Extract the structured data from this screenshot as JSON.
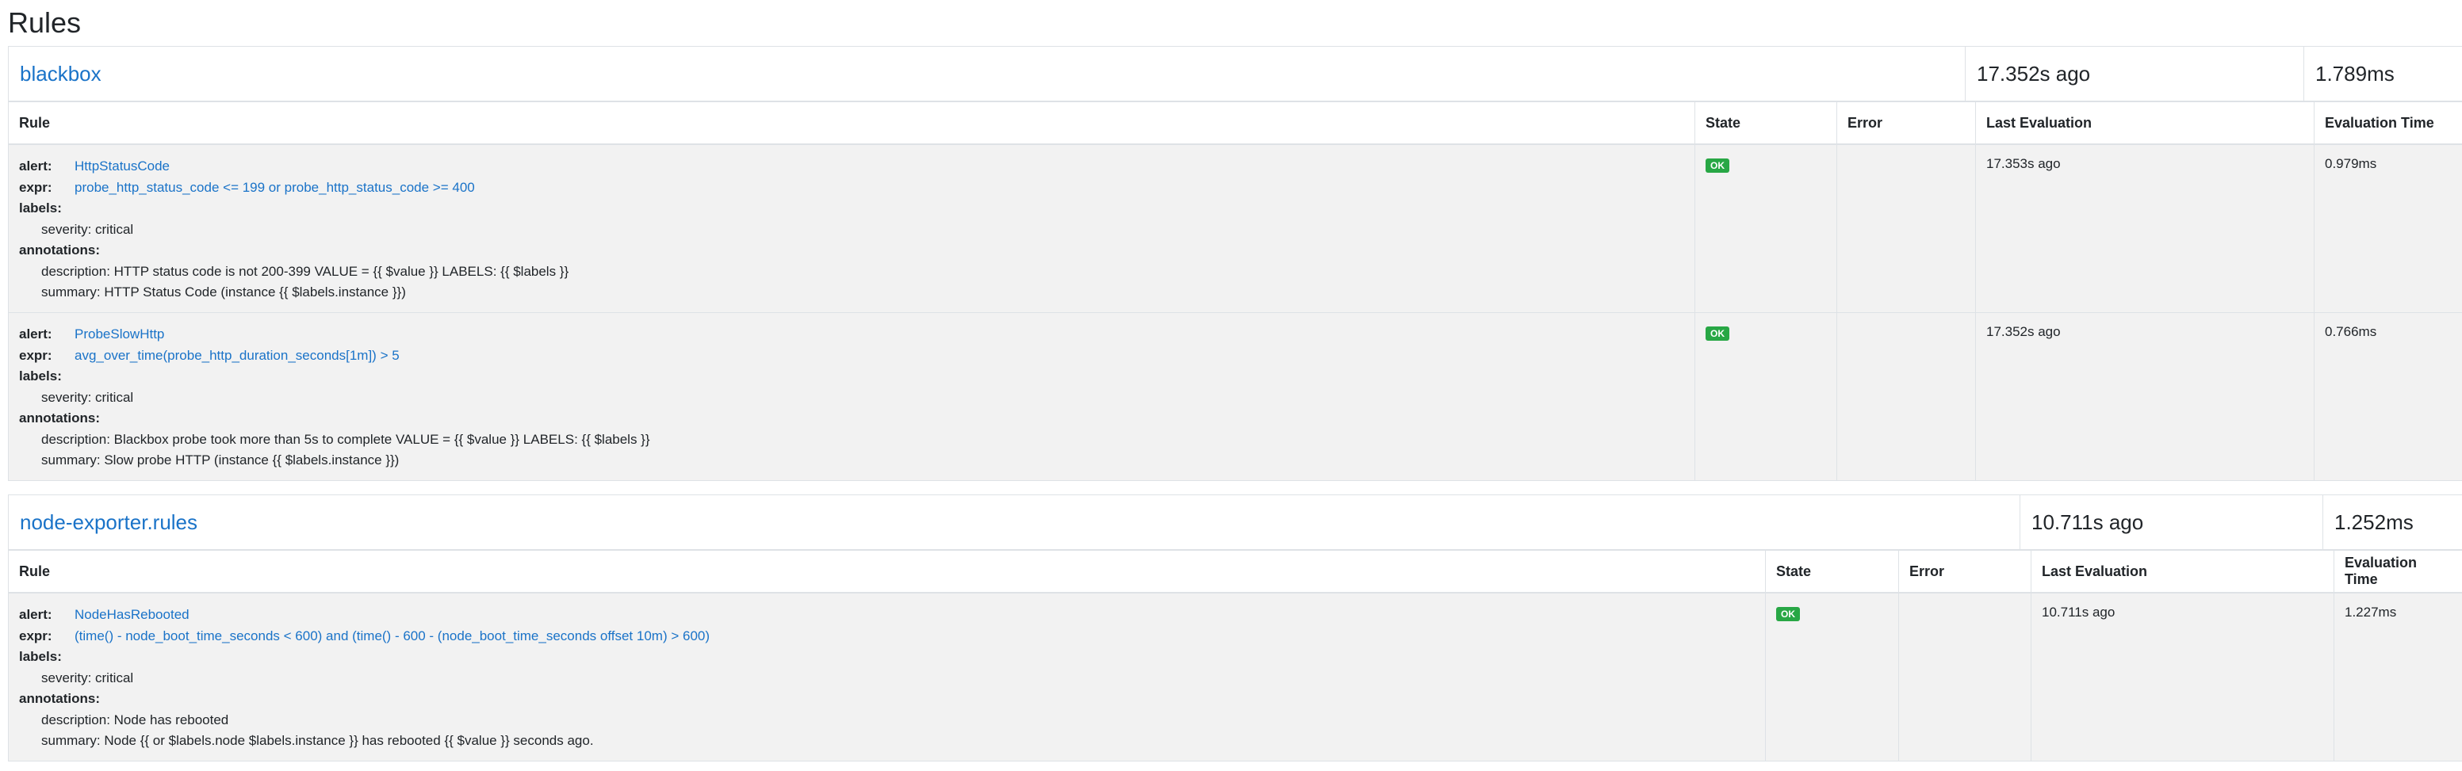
{
  "page": {
    "title": "Rules"
  },
  "columns": {
    "rule": "Rule",
    "state": "State",
    "error": "Error",
    "last_evaluation": "Last Evaluation",
    "evaluation_time": "Evaluation Time"
  },
  "keys": {
    "alert": "alert:",
    "expr": "expr:",
    "labels": "labels:",
    "annotations": "annotations:"
  },
  "groups": [
    {
      "name": "blackbox",
      "last_evaluation": "17.352s ago",
      "evaluation_time": "1.789ms",
      "rules": [
        {
          "alert": "HttpStatusCode",
          "expr": "probe_http_status_code <= 199 or probe_http_status_code >= 400",
          "labels": [
            "severity: critical"
          ],
          "annotations": [
            "description: HTTP status code is not 200-399 VALUE = {{ $value }} LABELS: {{ $labels }}",
            "summary: HTTP Status Code (instance {{ $labels.instance }})"
          ],
          "state": "OK",
          "error": "",
          "last_evaluation": "17.353s ago",
          "evaluation_time": "0.979ms"
        },
        {
          "alert": "ProbeSlowHttp",
          "expr": "avg_over_time(probe_http_duration_seconds[1m]) > 5",
          "labels": [
            "severity: critical"
          ],
          "annotations": [
            "description: Blackbox probe took more than 5s to complete VALUE = {{ $value }} LABELS: {{ $labels }}",
            "summary: Slow probe HTTP (instance {{ $labels.instance }})"
          ],
          "state": "OK",
          "error": "",
          "last_evaluation": "17.352s ago",
          "evaluation_time": "0.766ms"
        }
      ]
    },
    {
      "name": "node-exporter.rules",
      "last_evaluation": "10.711s ago",
      "evaluation_time": "1.252ms",
      "rules": [
        {
          "alert": "NodeHasRebooted",
          "expr": "(time() - node_boot_time_seconds < 600) and (time() - 600 - (node_boot_time_seconds offset 10m) > 600)",
          "labels": [
            "severity: critical"
          ],
          "annotations": [
            "description: Node has rebooted",
            "summary: Node {{ or $labels.node $labels.instance }} has rebooted {{ $value }} seconds ago."
          ],
          "state": "OK",
          "error": "",
          "last_evaluation": "10.711s ago",
          "evaluation_time": "1.227ms"
        }
      ]
    }
  ]
}
